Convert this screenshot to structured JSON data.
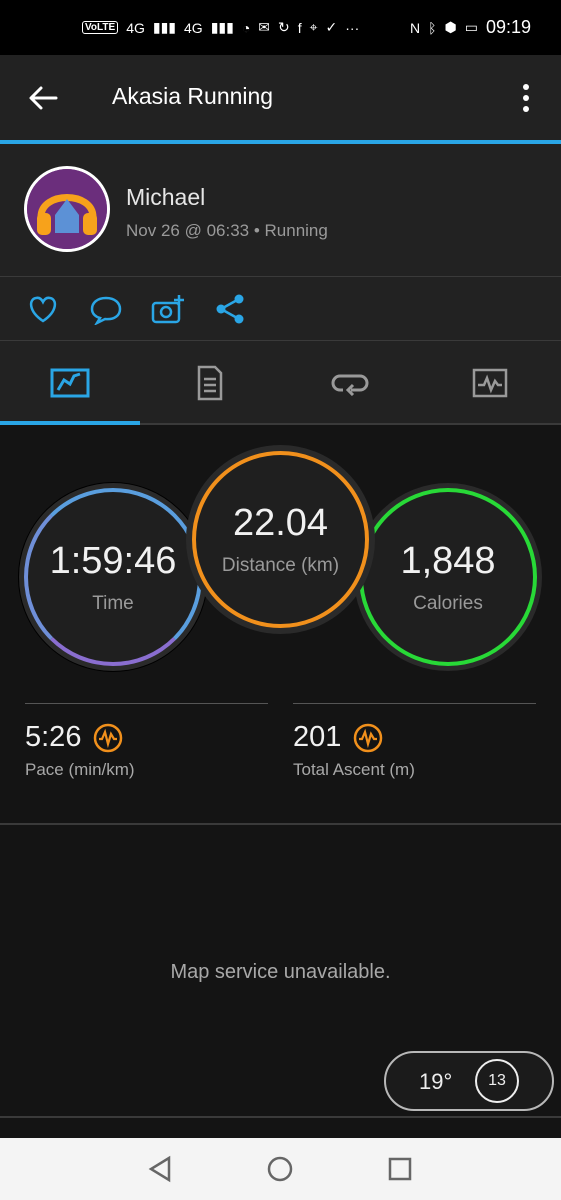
{
  "status_bar": {
    "time": "09:19",
    "volte": "VoLTE",
    "signal_labels": [
      "4G",
      "4G"
    ],
    "overflow": "···"
  },
  "header": {
    "title": "Akasia Running"
  },
  "profile": {
    "name": "Michael",
    "meta": "Nov 26 @ 06:33 • Running"
  },
  "actions": [
    "like-icon",
    "comment-icon",
    "add-photo-icon",
    "share-icon"
  ],
  "tabs": [
    "overview-tab",
    "details-tab",
    "laps-tab",
    "charts-tab"
  ],
  "stats": {
    "time": {
      "value": "1:59:46",
      "label": "Time",
      "color": "#6f8fd8"
    },
    "distance": {
      "value": "22.04",
      "label": "Distance (km)",
      "color": "#f1901c"
    },
    "calories": {
      "value": "1,848",
      "label": "Calories",
      "color": "#28d937"
    }
  },
  "metrics": {
    "pace": {
      "value": "5:26",
      "label": "Pace (min/km)"
    },
    "ascent": {
      "value": "201",
      "label": "Total Ascent (m)"
    }
  },
  "map": {
    "message": "Map service unavailable.",
    "temperature": "19°",
    "wind": "13"
  },
  "colors": {
    "accent": "#2aa6e6",
    "orange_icon": "#f1901c"
  }
}
